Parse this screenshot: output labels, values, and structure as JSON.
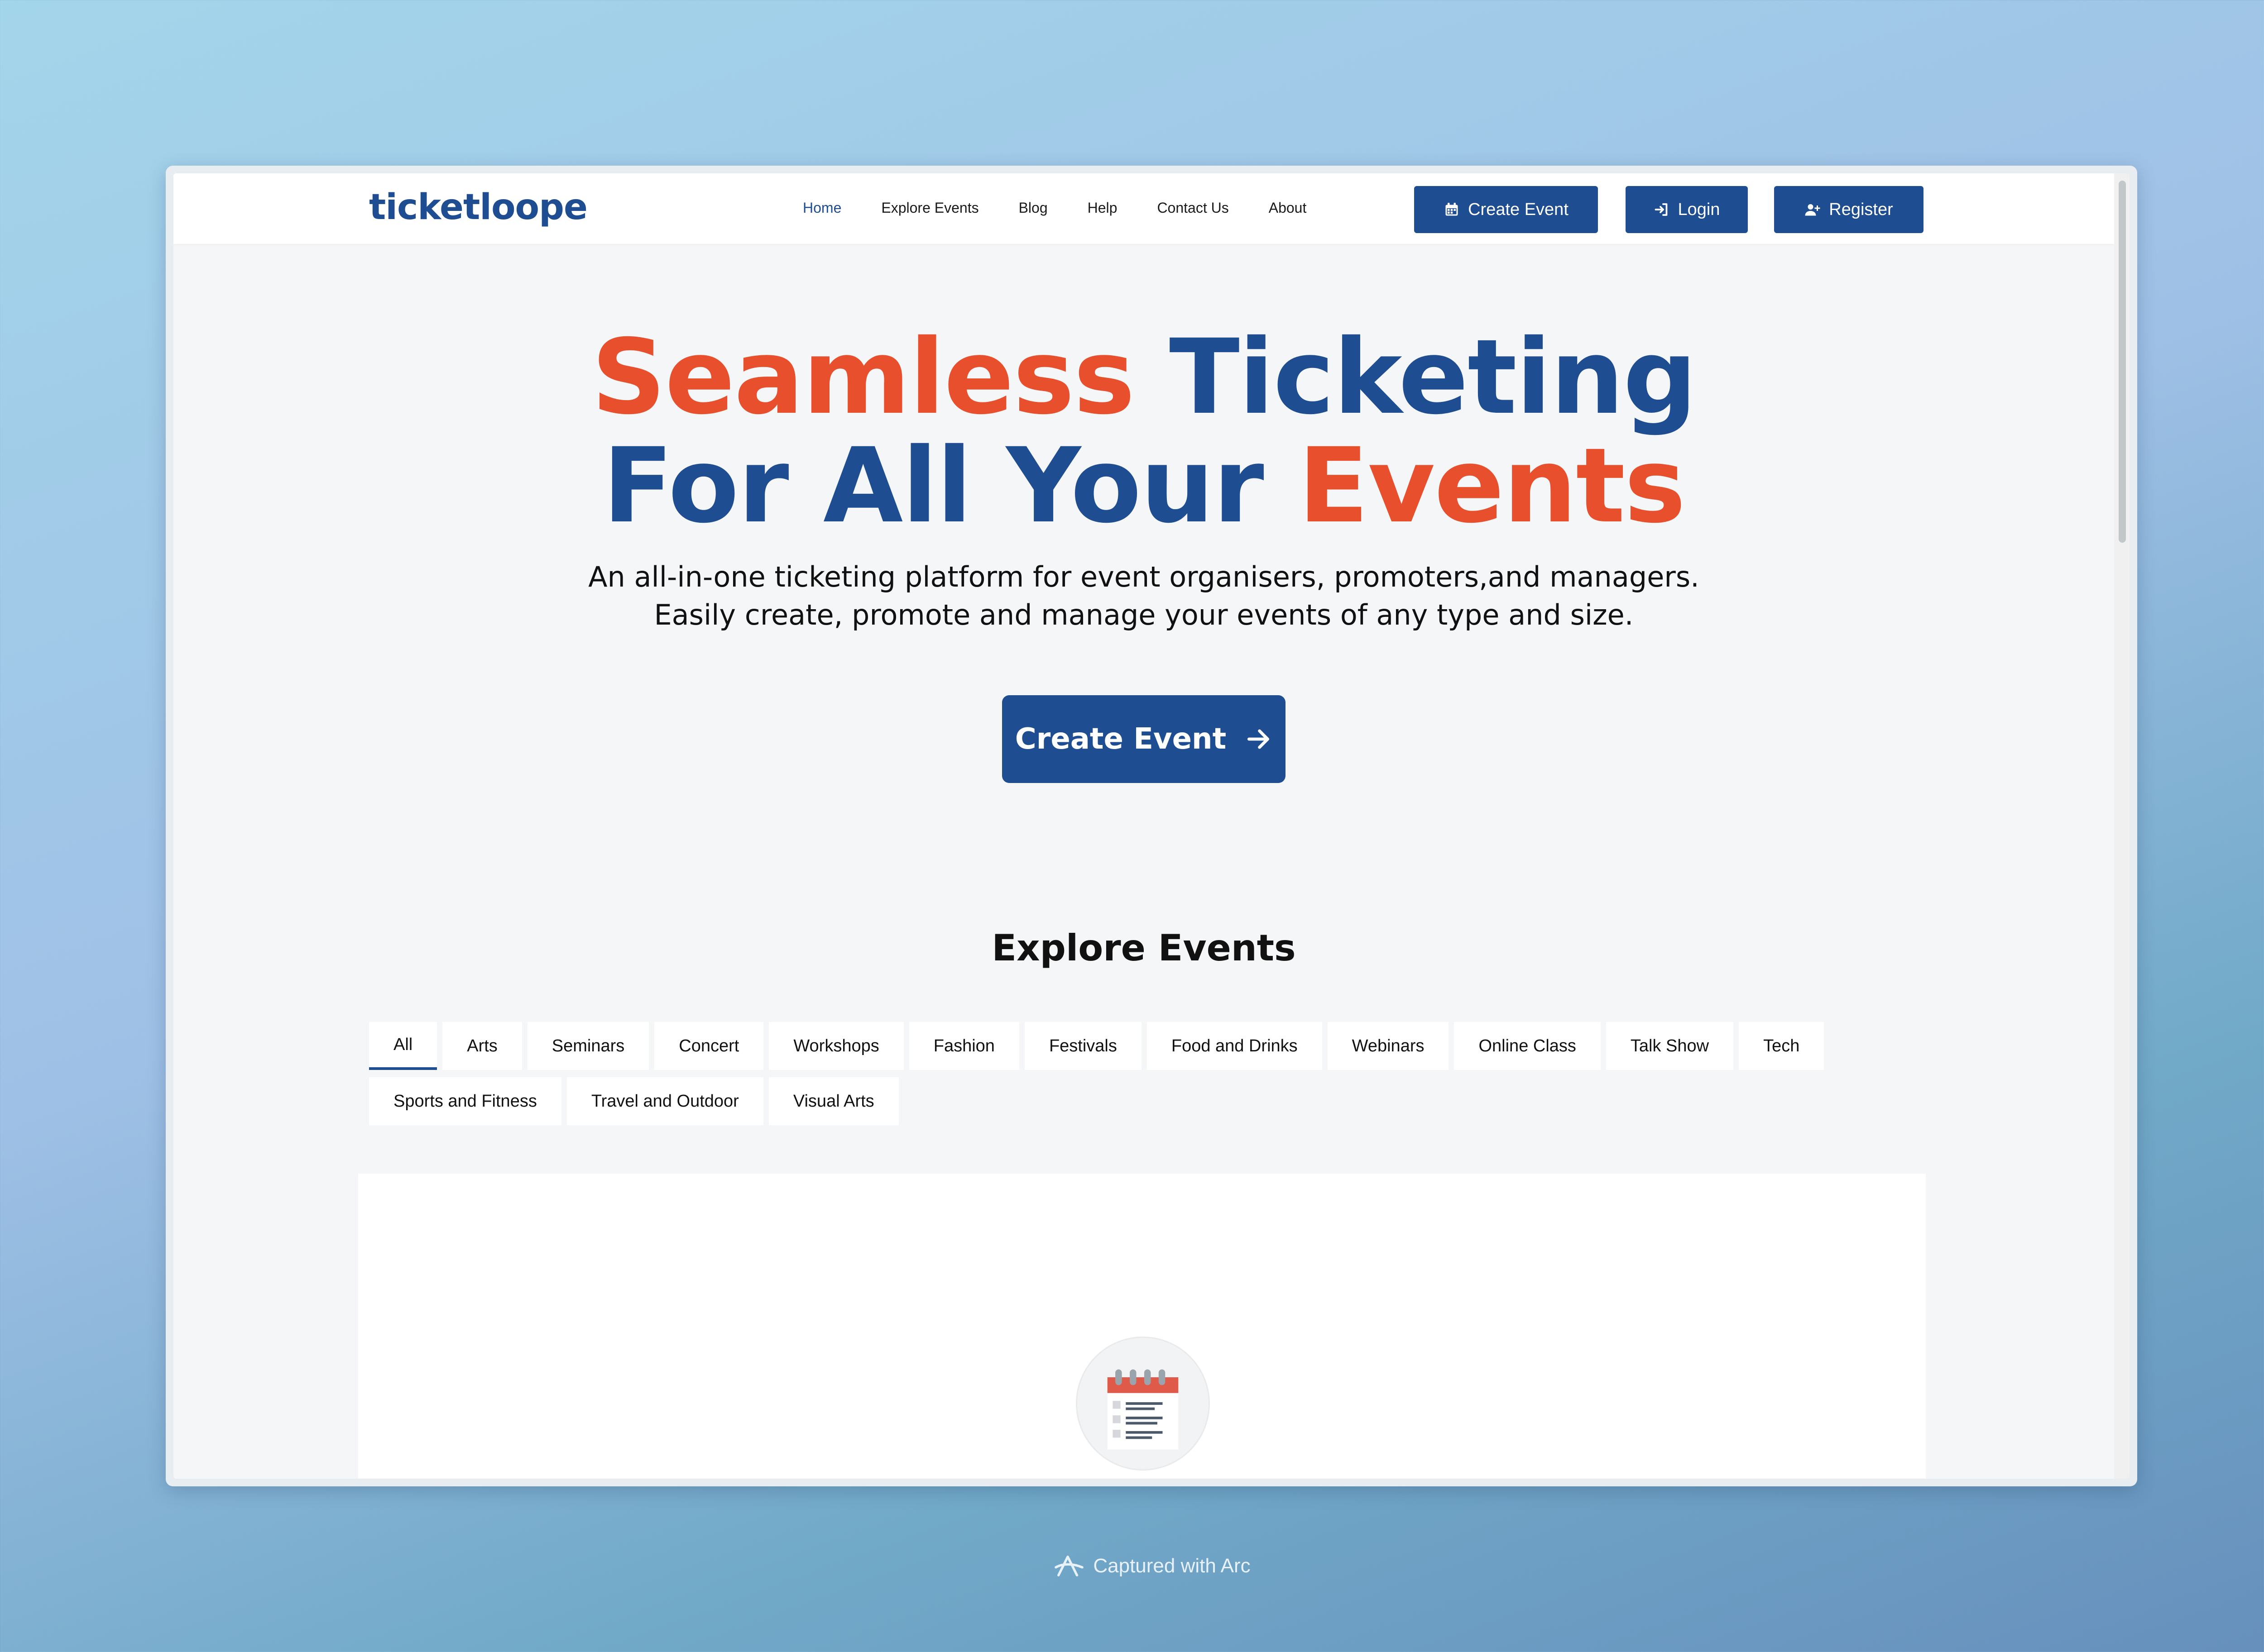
{
  "brand": {
    "logo_text": "ticketloope"
  },
  "nav": {
    "links": [
      "Home",
      "Explore Events",
      "Blog",
      "Help",
      "Contact Us",
      "About"
    ],
    "create_event": "Create Event",
    "login": "Login",
    "register": "Register"
  },
  "hero": {
    "title_word1": "Seamless",
    "title_word2": "Ticketing",
    "title_line2_part1": "For All Your",
    "title_line2_part2": "Events",
    "subtitle_line1": "An all-in-one ticketing platform for event organisers, promoters,and managers.",
    "subtitle_line2": "Easily create, promote and manage your events of any type and size.",
    "cta_label": "Create Event"
  },
  "explore": {
    "title": "Explore Events",
    "categories_row1": [
      "All",
      "Arts",
      "Seminars",
      "Concert",
      "Workshops",
      "Fashion",
      "Festivals",
      "Food and Drinks",
      "Webinars",
      "Online Class",
      "Talk Show",
      "Tech"
    ],
    "categories_row2": [
      "Sports and Fitness",
      "Travel and Outdoor",
      "Visual Arts"
    ],
    "active_category": "All"
  },
  "footer_badge": {
    "text": "Captured with Arc"
  },
  "colors": {
    "brand_blue": "#1e4d91",
    "accent_orange": "#e8502d"
  }
}
